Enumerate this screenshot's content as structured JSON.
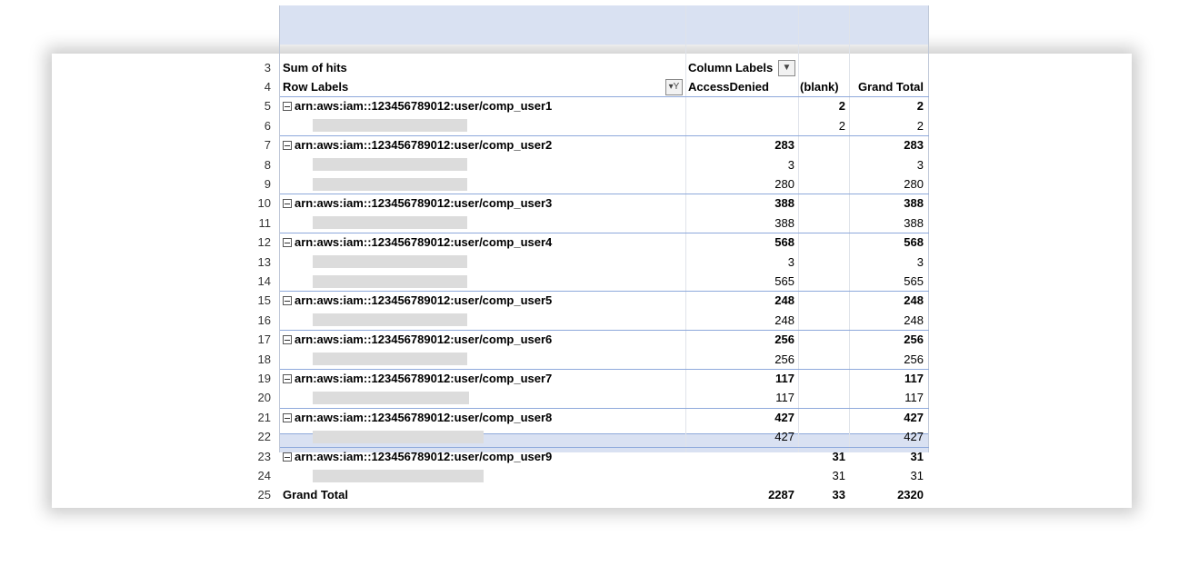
{
  "pivot": {
    "sum_label": "Sum of hits",
    "column_labels": "Column Labels",
    "row_labels": "Row Labels",
    "col_access_denied": "AccessDenied",
    "col_blank": "(blank)",
    "col_grand_total": "Grand Total",
    "dropdown_icon": "dropdown-arrow-icon",
    "filter_icon": "filter-funnel-icon",
    "rows": [
      {
        "n": "3"
      },
      {
        "n": "4"
      },
      {
        "n": "5",
        "label": "arn:aws:iam::123456789012:user/comp_user1",
        "ad": "",
        "bl": "2",
        "gt": "2",
        "group": true
      },
      {
        "n": "6",
        "ad": "",
        "bl": "2",
        "gt": "2"
      },
      {
        "n": "7",
        "label": "arn:aws:iam::123456789012:user/comp_user2",
        "ad": "283",
        "bl": "",
        "gt": "283",
        "group": true
      },
      {
        "n": "8",
        "ad": "3",
        "bl": "",
        "gt": "3"
      },
      {
        "n": "9",
        "ad": "280",
        "bl": "",
        "gt": "280"
      },
      {
        "n": "10",
        "label": "arn:aws:iam::123456789012:user/comp_user3",
        "ad": "388",
        "bl": "",
        "gt": "388",
        "group": true
      },
      {
        "n": "11",
        "ad": "388",
        "bl": "",
        "gt": "388"
      },
      {
        "n": "12",
        "label": "arn:aws:iam::123456789012:user/comp_user4",
        "ad": "568",
        "bl": "",
        "gt": "568",
        "group": true
      },
      {
        "n": "13",
        "ad": "3",
        "bl": "",
        "gt": "3"
      },
      {
        "n": "14",
        "ad": "565",
        "bl": "",
        "gt": "565"
      },
      {
        "n": "15",
        "label": "arn:aws:iam::123456789012:user/comp_user5",
        "ad": "248",
        "bl": "",
        "gt": "248",
        "group": true
      },
      {
        "n": "16",
        "ad": "248",
        "bl": "",
        "gt": "248"
      },
      {
        "n": "17",
        "label": "arn:aws:iam::123456789012:user/comp_user6",
        "ad": "256",
        "bl": "",
        "gt": "256",
        "group": true
      },
      {
        "n": "18",
        "ad": "256",
        "bl": "",
        "gt": "256"
      },
      {
        "n": "19",
        "label": "arn:aws:iam::123456789012:user/comp_user7",
        "ad": "117",
        "bl": "",
        "gt": "117",
        "group": true
      },
      {
        "n": "20",
        "ad": "117",
        "bl": "",
        "gt": "117"
      },
      {
        "n": "21",
        "label": "arn:aws:iam::123456789012:user/comp_user8",
        "ad": "427",
        "bl": "",
        "gt": "427",
        "group": true
      },
      {
        "n": "22",
        "ad": "427",
        "bl": "",
        "gt": "427"
      },
      {
        "n": "23",
        "label": "arn:aws:iam::123456789012:user/comp_user9",
        "ad": "",
        "bl": "31",
        "gt": "31",
        "group": true
      },
      {
        "n": "24",
        "ad": "",
        "bl": "31",
        "gt": "31"
      },
      {
        "n": "25",
        "label": "Grand Total",
        "ad": "2287",
        "bl": "33",
        "gt": "2320",
        "total": true
      }
    ]
  }
}
